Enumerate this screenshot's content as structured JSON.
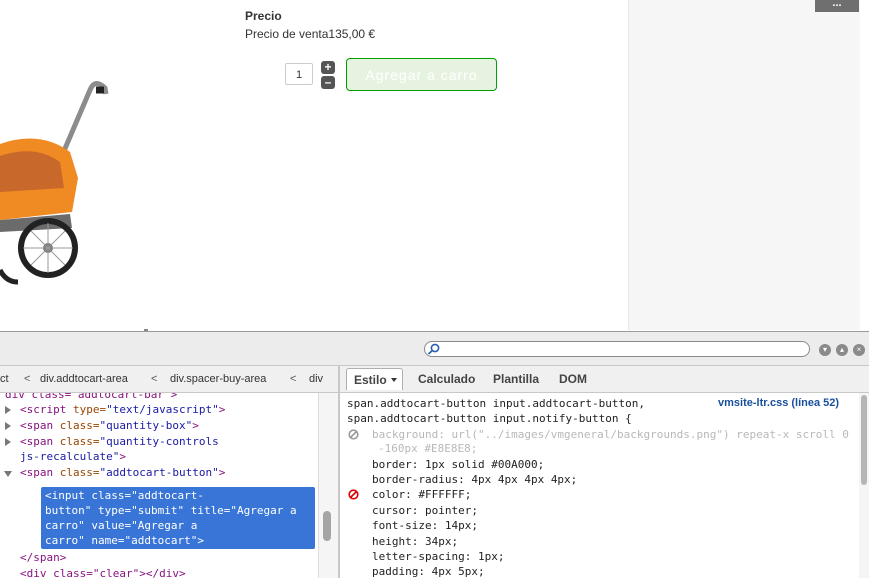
{
  "page": {
    "precio_label": "Precio",
    "precio_venta_label": "Precio de venta",
    "precio_venta_value": "135,00 €",
    "quantity_value": "1",
    "plus_symbol": "+",
    "minus_symbol": "–",
    "add_to_cart_label": "Agregar a carro",
    "corner_button_label": "..."
  },
  "devtools": {
    "breadcrumbs": [
      "ct",
      "div.addtocart-area",
      "div.spacer-buy-area",
      "div"
    ],
    "breadcrumb_separator": "<",
    "tree": {
      "partial_top": "div class=\"addtocart-bar\">",
      "script_tag": "<script",
      "script_attr": " type=",
      "script_val": "\"text/javascript\"",
      "script_end": ">",
      "span1_tag": "<span",
      "span1_attr": " class=",
      "span1_val": "\"quantity-box\"",
      "span1_end": ">",
      "span2_tag": "<span",
      "span2_attr": " class=",
      "span2_val": "\"quantity-controls",
      "span2_val2": "js-recalculate\"",
      "span2_end": ">",
      "span3_tag": "<span",
      "span3_attr": " class=",
      "span3_val": "\"addtocart-button\"",
      "span3_end": ">",
      "selected_lines": [
        "<input class=\"addtocart-",
        "button\" type=\"submit\" title=\"Agregar a",
        "carro\" value=\"Agregar a",
        "carro\" name=\"addtocart\">"
      ],
      "close_span": "</span>",
      "partial_bottom": "<div class=\"clear\"></div>"
    },
    "tabs": {
      "estilo": "Estilo",
      "calculado": "Calculado",
      "plantilla": "Plantilla",
      "dom": "DOM"
    },
    "styles": {
      "selector_line1": "span.addtocart-button input.addtocart-button,",
      "selector_line2": "span.addtocart-button input.notify-button {",
      "source_link": "vmsite-ltr.css (línea 52)",
      "bg_line1": "background: url(\"../images/vmgeneral/backgrounds.png\") repeat-x scroll 0",
      "bg_line2": "-160px #E8E8E8;",
      "props": [
        {
          "name": "border",
          "value": "1px solid #00A000;"
        },
        {
          "name": "border-radius",
          "value": "4px 4px 4px 4px;"
        },
        {
          "name": "color",
          "value": "#FFFFFF;"
        },
        {
          "name": "cursor",
          "value": "pointer;"
        },
        {
          "name": "font-size",
          "value": "14px;"
        },
        {
          "name": "height",
          "value": "34px;"
        },
        {
          "name": "letter-spacing",
          "value": "1px;"
        },
        {
          "name": "padding",
          "value": "4px 5px;"
        }
      ]
    },
    "colors": {
      "selection": "#3875d7",
      "button_border": "#00A000",
      "disabled_icon": "#9a9a9a",
      "overridden_icon": "#e00000"
    }
  }
}
